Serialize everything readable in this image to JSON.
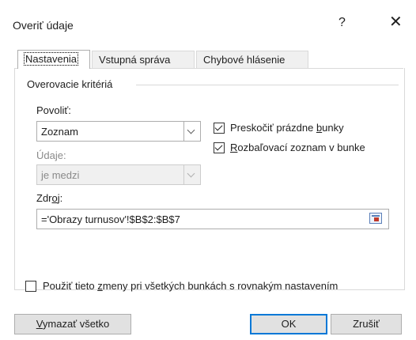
{
  "window": {
    "title": "Overiť údaje",
    "help_glyph": "?",
    "close_glyph": "✕"
  },
  "tabs": [
    {
      "label": "Nastavenia",
      "active": true
    },
    {
      "label": "Vstupná správa",
      "active": false
    },
    {
      "label": "Chybové hlásenie",
      "active": false
    }
  ],
  "criteria": {
    "group_label": "Overovacie kritériá",
    "allow": {
      "label": "Povoliť:",
      "value": "Zoznam"
    },
    "data": {
      "label": "Údaje:",
      "value": "je medzi"
    },
    "ignore_blank": {
      "label_pre": "Preskočiť prázdne ",
      "label_u": "b",
      "label_post": "unky",
      "checked": true
    },
    "in_cell_dropdown": {
      "label_u": "R",
      "label_post": "ozbaľovací zoznam v bunke",
      "checked": true
    },
    "source": {
      "label_pre": "Zdr",
      "label_u": "o",
      "label_post": "j:",
      "value": "='Obrazy turnusov'!$B$2:$B$7"
    }
  },
  "apply_all": {
    "label_pre": "Použiť tieto ",
    "label_u": "z",
    "label_post": "meny pri všetkých bunkách s rovnakým nastavením",
    "checked": false
  },
  "buttons": {
    "clear_all_u": "V",
    "clear_all_post": "ymazať všetko",
    "ok": "OK",
    "cancel": "Zrušiť"
  },
  "colors": {
    "accent": "#0078d7",
    "button_bg": "#e1e1e1",
    "border": "#adadad"
  }
}
